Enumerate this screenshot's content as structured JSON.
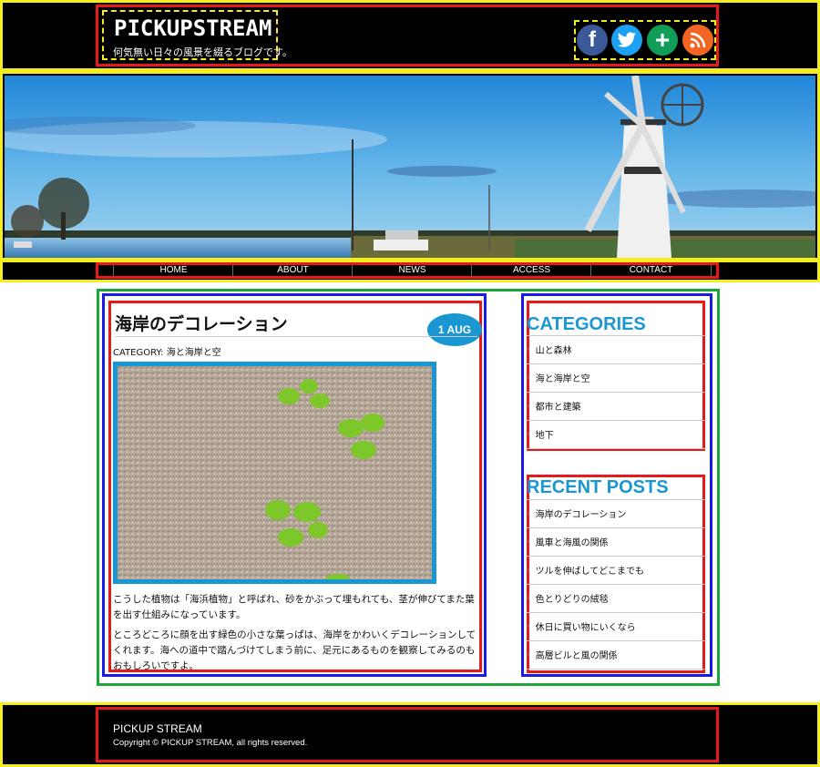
{
  "header": {
    "logo": "PICKUPSTREAM",
    "tagline": "何気無い日々の風景を綴るブログです。",
    "social": [
      {
        "icon": "facebook-icon",
        "glyph": "f",
        "color": "#3b5998"
      },
      {
        "icon": "twitter-icon",
        "glyph": "♣",
        "color": "#1da1f2"
      },
      {
        "icon": "google-plus-icon",
        "glyph": "+",
        "color": "#0f9d58"
      },
      {
        "icon": "rss-icon",
        "glyph": "◣",
        "color": "#f26522"
      }
    ]
  },
  "hero": {
    "alt": "windmill-landscape"
  },
  "nav": {
    "items": [
      "HOME",
      "ABOUT",
      "NEWS",
      "ACCESS",
      "CONTACT"
    ]
  },
  "article": {
    "title": "海岸のデコレーション",
    "date": "1 AUG",
    "category": "CATEGORY: 海と海岸と空",
    "paragraphs": [
      "こうした植物は「海浜植物」と呼ばれ、砂をかぶって埋もれても、茎が伸びてまた葉を出す仕組みになっています。",
      "ところどころに顔を出す緑色の小さな葉っぱは、海岸をかわいくデコレーションしてくれます。海への道中で踏んづけてしまう前に、足元にあるものを観察してみるのもおもしろいですよ。"
    ]
  },
  "sidebar": {
    "categories_heading": "CATEGORIES",
    "categories": [
      "山と森林",
      "海と海岸と空",
      "都市と建築",
      "地下"
    ],
    "recent_heading": "RECENT POSTS",
    "recent": [
      "海岸のデコレーション",
      "風車と海風の関係",
      "ツルを伸ばしてどこまでも",
      "色とりどりの絨毯",
      "休日に買い物にいくなら",
      "高層ビルと風の関係"
    ]
  },
  "footer": {
    "title": "PICKUP STREAM",
    "copyright": "Copyright © PICKUP STREAM, all rights reserved."
  },
  "colors": {
    "accent": "#1a96d2",
    "annotation_red": "#e61a1a",
    "annotation_yellow": "#f4ee1e",
    "annotation_blue": "#1a1ae6",
    "annotation_green": "#1aa63a"
  }
}
